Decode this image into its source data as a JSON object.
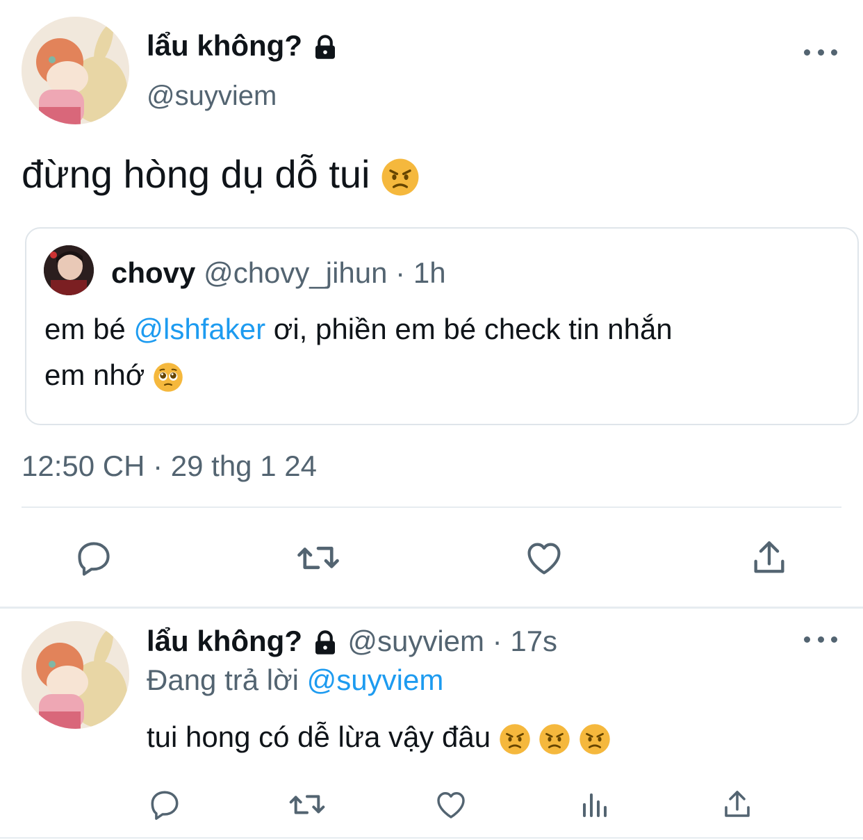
{
  "main_tweet": {
    "display_name": "lẩu không?",
    "handle": "@suyviem",
    "text": "đừng hòng dụ dỗ tui",
    "emoji_icon": "angry-face-icon",
    "timestamp": "12:50 CH · 29 thg 1 24",
    "quote": {
      "display_name": "chovy",
      "handle_time": "@chovy_jihun · 1h",
      "text_before": "em bé ",
      "mention": "@lshfaker",
      "text_after": " ơi, phiền em bé check tin nhắn",
      "text_line2": "em nhớ",
      "emoji_icon": "pleading-face-icon"
    }
  },
  "reply_tweet": {
    "display_name": "lẩu không?",
    "handle_time": "@suyviem · 17s",
    "replying_label": "Đang trả lời ",
    "replying_to": "@suyviem",
    "text": "tui hong có dễ lừa vậy đâu",
    "emoji_icons": [
      "angry-face-icon",
      "angry-face-icon",
      "angry-face-icon"
    ]
  },
  "colors": {
    "text": "#0f1419",
    "muted": "#536471",
    "link": "#1d9bf0",
    "divider": "#e6ecf0",
    "emoji": "#f5b83d"
  },
  "icons": {
    "lock": "lock-icon",
    "more": "more-icon",
    "reply": "reply-icon",
    "retweet": "retweet-icon",
    "like": "heart-icon",
    "share": "share-icon",
    "views": "views-icon"
  }
}
